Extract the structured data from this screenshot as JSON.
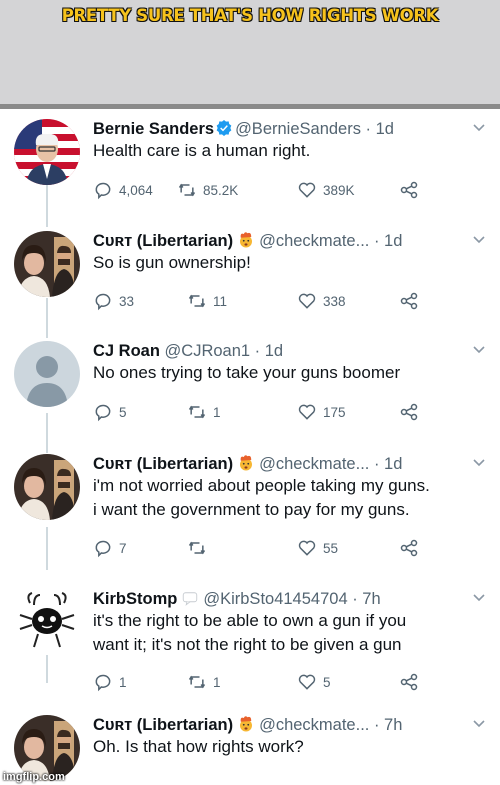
{
  "meme": {
    "caption": "PRETTY SURE THAT'S HOW RIGHTS WORK",
    "watermark": "imgflip.com"
  },
  "colors": {
    "caption": "#f6c21c",
    "verified": "#1d9bf0",
    "text": "#0f1419",
    "muted": "#536471"
  },
  "tweets": [
    {
      "name": "Bernie Sanders",
      "handle": "@BernieSanders · 1d",
      "text": "Health care is a human right.",
      "replies": "4,064",
      "retweets": "85.2K",
      "likes": "389K",
      "avatar": "bernie-avatar",
      "badge": "verified-icon"
    },
    {
      "name": "Cᴜʀᴛ (Libertarian)",
      "handle": "@checkmate... · 1d",
      "text": "So is gun ownership!",
      "replies": "33",
      "retweets": "11",
      "likes": "338",
      "avatar": "curt-avatar",
      "badge": "exploding-head-emoji"
    },
    {
      "name": "CJ Roan",
      "handle": "@CJRoan1 · 1d",
      "text": "No ones trying to take your guns boomer",
      "replies": "5",
      "retweets": "1",
      "likes": "175",
      "avatar": "default-avatar"
    },
    {
      "name": "Cᴜʀᴛ (Libertarian)",
      "handle": "@checkmate... · 1d",
      "text_line1": "i'm not worried about people taking my guns.",
      "text_line2": "i want the government to pay for my guns.",
      "replies": "7",
      "retweets": "",
      "likes": "55",
      "avatar": "curt-avatar",
      "badge": "exploding-head-emoji"
    },
    {
      "name": "KirbStomp",
      "handle": "@KirbSto41454704 · 7h",
      "text_line1": "it's the right to be able to own a gun if you",
      "text_line2": "want it; it's not the right to be given a gun",
      "replies": "1",
      "retweets": "1",
      "likes": "5",
      "avatar": "cartoon-avatar",
      "badge": "speech-bubble-emoji"
    },
    {
      "name": "Cᴜʀᴛ (Libertarian)",
      "handle": "@checkmate... · 7h",
      "text": "Oh. Is that how rights work?",
      "avatar": "curt-avatar",
      "badge": "exploding-head-emoji"
    }
  ]
}
